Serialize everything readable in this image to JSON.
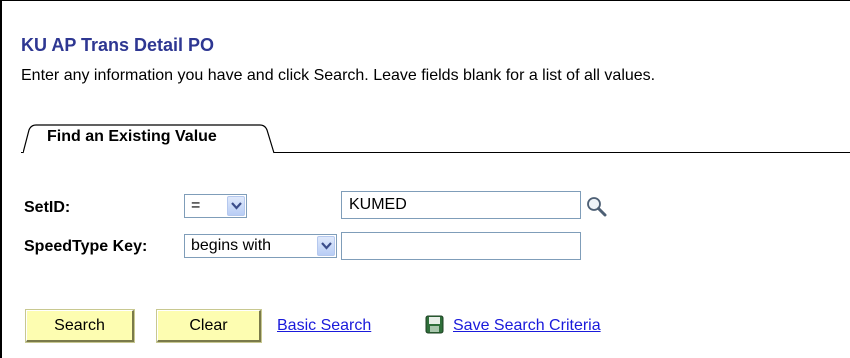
{
  "page": {
    "title": "KU AP Trans Detail PO",
    "instructions": "Enter any information you have and click Search. Leave fields blank for a list of all values."
  },
  "tabs": [
    {
      "label": "Find an Existing Value",
      "active": true
    }
  ],
  "form": {
    "setid": {
      "label": "SetID:",
      "operator": "=",
      "value": "KUMED"
    },
    "speedtype": {
      "label": "SpeedType Key:",
      "operator": "begins with",
      "value": ""
    }
  },
  "actions": {
    "search_label": "Search",
    "clear_label": "Clear",
    "basic_search_label": "Basic Search",
    "save_criteria_label": "Save Search Criteria"
  },
  "icons": {
    "lookup": "magnifier-icon",
    "save": "floppy-disk-icon",
    "dropdown": "chevron-down-icon"
  },
  "colors": {
    "title": "#2e3792",
    "button_bg": "#fdfdb1",
    "link": "#1a1adb"
  }
}
